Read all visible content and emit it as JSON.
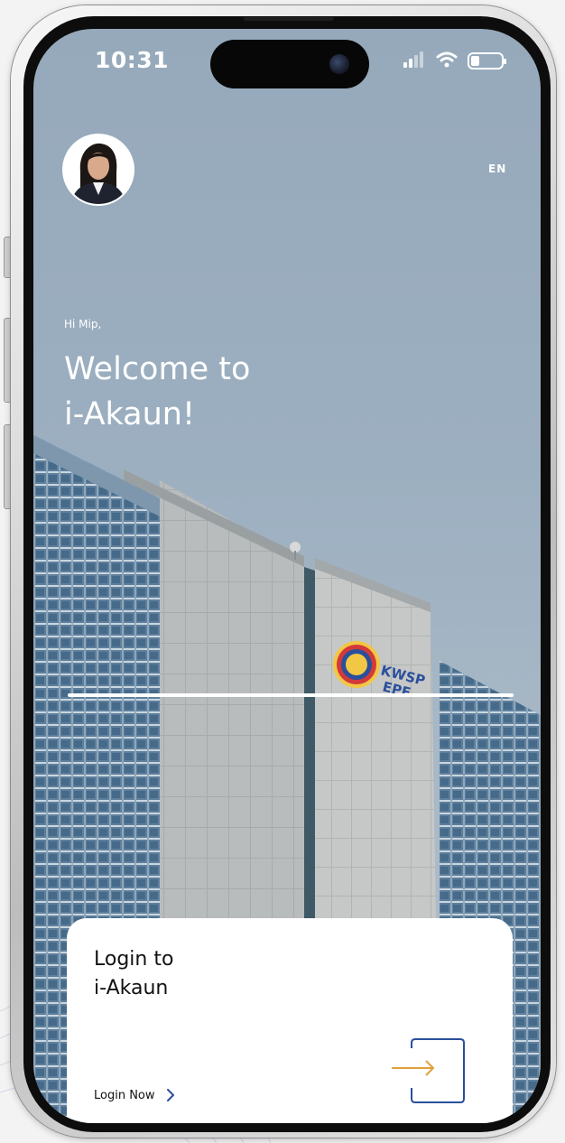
{
  "status_bar": {
    "time": "10:31"
  },
  "header": {
    "avatar_icon": "user-avatar",
    "language": "EN"
  },
  "greeting": {
    "hi": "Hi Mip,",
    "title_line1": "Welcome to",
    "title_line2": "i-Akaun!"
  },
  "hero": {
    "building_sign_line1": "KWSP",
    "building_sign_line2": "EPF"
  },
  "login_card": {
    "title_line1": "Login to",
    "title_line2": "i-Akaun",
    "link_label": "Login Now",
    "icon": "login-door-icon"
  },
  "colors": {
    "sky": "#9cafc0",
    "accent_blue": "#2a4f9c",
    "accent_orange": "#e0a13a",
    "card_bg": "#ffffff"
  }
}
